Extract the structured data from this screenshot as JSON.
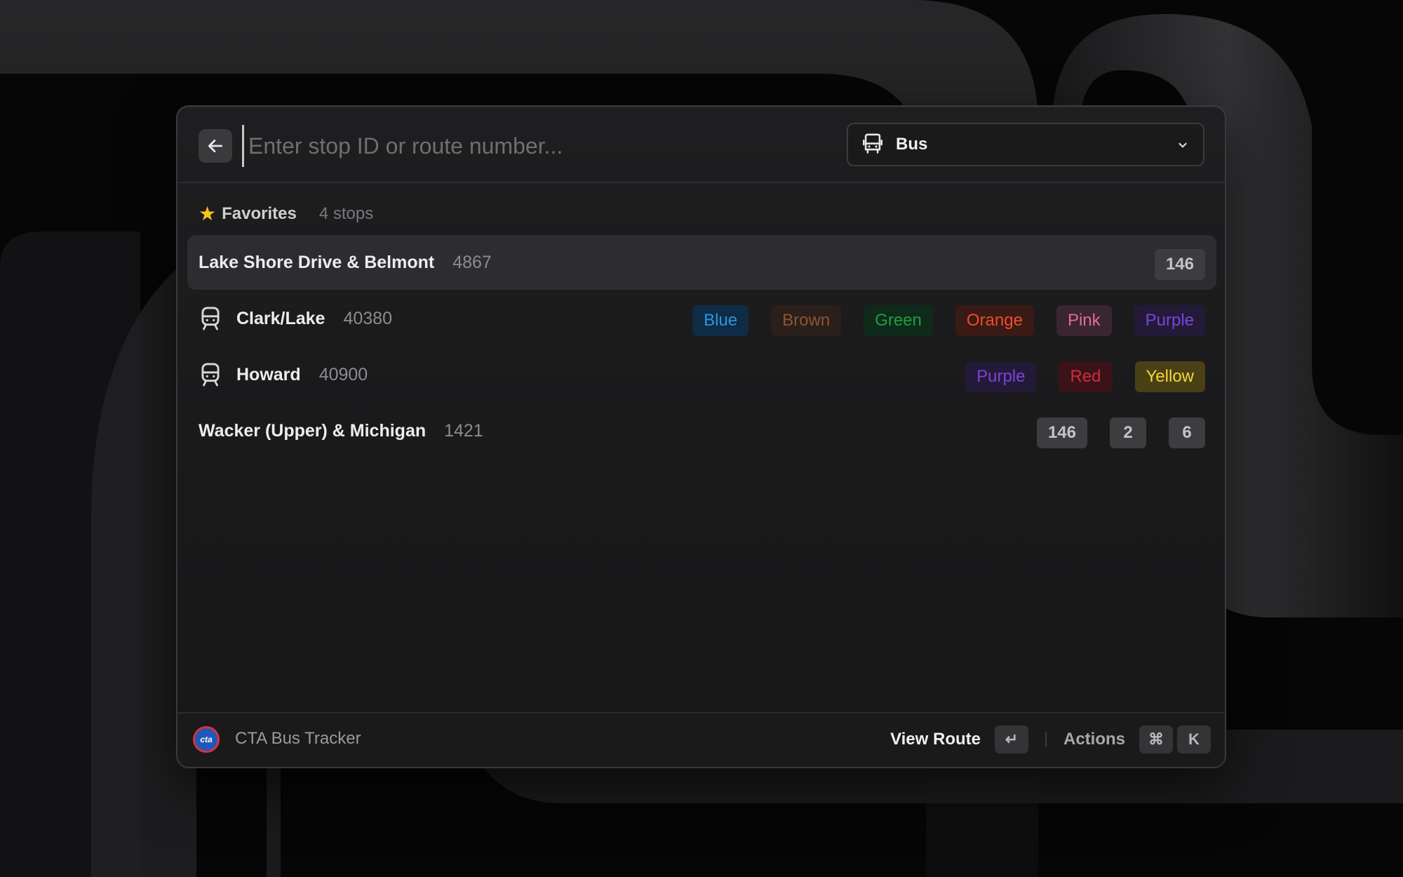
{
  "search": {
    "placeholder": "Enter stop ID or route number..."
  },
  "mode_dropdown": {
    "selected": "Bus",
    "icon": "bus-icon"
  },
  "section": {
    "icon": "star-icon",
    "title": "Favorites",
    "count": "4 stops"
  },
  "stops": [
    {
      "name": "Lake Shore Drive & Belmont",
      "id": "4867",
      "type": "bus",
      "routes": [
        "146"
      ],
      "selected": true
    },
    {
      "name": "Clark/Lake",
      "id": "40380",
      "type": "train",
      "routes": [
        "Blue",
        "Brown",
        "Green",
        "Orange",
        "Pink",
        "Purple"
      ]
    },
    {
      "name": "Howard",
      "id": "40900",
      "type": "train",
      "routes": [
        "Purple",
        "Red",
        "Yellow"
      ]
    },
    {
      "name": "Wacker (Upper) & Michigan",
      "id": "1421",
      "type": "bus",
      "routes": [
        "146",
        "2",
        "6"
      ]
    }
  ],
  "footer": {
    "logo_text": "cta",
    "app_name": "CTA Bus Tracker",
    "primary_action": "View Route",
    "primary_shortcut": "↵",
    "secondary_action": "Actions",
    "secondary_shortcut": [
      "⌘",
      "K"
    ]
  },
  "colors": {
    "Blue": "#2e95e0",
    "Brown": "#8b5534",
    "Green": "#1f9f44",
    "Orange": "#ee4a32",
    "Pink": "#e06f96",
    "Purple": "#7a45d6",
    "Red": "#d22a3a",
    "Yellow": "#f4d735"
  }
}
